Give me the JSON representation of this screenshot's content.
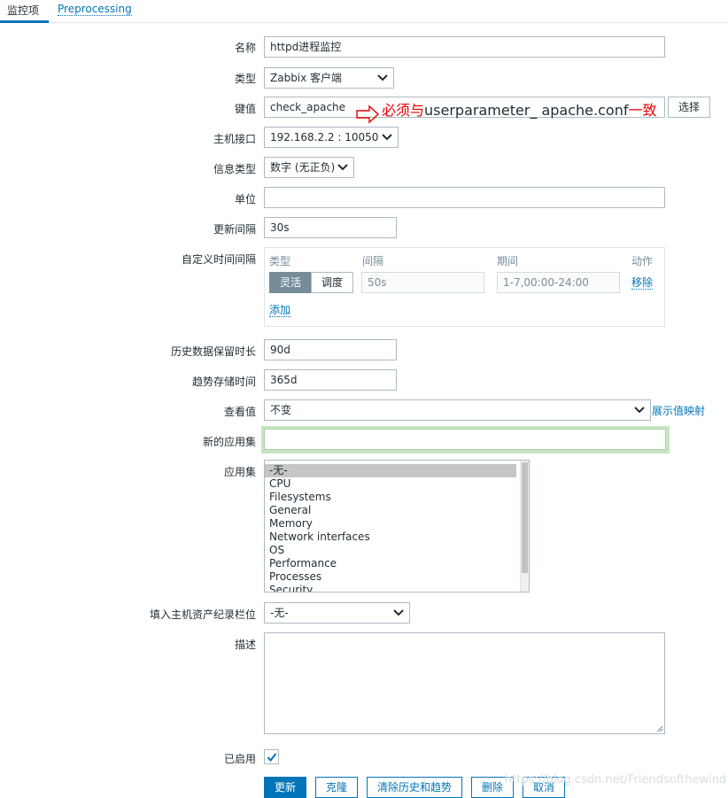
{
  "tabs": {
    "item": "监控项",
    "preprocessing": "Preprocessing"
  },
  "form": {
    "name": {
      "label": "名称",
      "value": "httpd进程监控"
    },
    "type": {
      "label": "类型",
      "value": "Zabbix 客户端"
    },
    "key": {
      "label": "键值",
      "value": "check_apache",
      "select_button": "选择"
    },
    "annotation": {
      "prefix": "必须与",
      "middle": "userparameter_ apache.conf",
      "suffix": "一致"
    },
    "host_interface": {
      "label": "主机接口",
      "value": "192.168.2.2 : 10050"
    },
    "info_type": {
      "label": "信息类型",
      "value": "数字 (无正负)"
    },
    "units": {
      "label": "单位",
      "value": ""
    },
    "update_interval": {
      "label": "更新间隔",
      "value": "30s"
    },
    "custom_intervals": {
      "label": "自定义时间间隔",
      "headers": {
        "type": "类型",
        "interval": "间隔",
        "period": "期间",
        "action": "动作"
      },
      "flexible": "灵活",
      "scheduling": "调度",
      "interval_placeholder": "50s",
      "period_placeholder": "1-7,00:00-24:00",
      "remove": "移除",
      "add": "添加"
    },
    "history": {
      "label": "历史数据保留时长",
      "value": "90d"
    },
    "trends": {
      "label": "趋势存储时间",
      "value": "365d"
    },
    "show_value": {
      "label": "查看值",
      "value": "不变",
      "link": "展示值映射"
    },
    "new_application": {
      "label": "新的应用集",
      "value": ""
    },
    "applications": {
      "label": "应用集",
      "items": [
        "-无-",
        "CPU",
        "Filesystems",
        "General",
        "Memory",
        "Network interfaces",
        "OS",
        "Performance",
        "Processes",
        "Security"
      ],
      "selected": "-无-"
    },
    "inventory": {
      "label": "填入主机资产纪录栏位",
      "value": "-无-"
    },
    "description": {
      "label": "描述",
      "value": ""
    },
    "enabled": {
      "label": "已启用",
      "checked": true
    }
  },
  "buttons": {
    "update": "更新",
    "clone": "克隆",
    "clear": "清除历史和趋势",
    "delete": "删除",
    "cancel": "取消"
  },
  "watermark": "https://blog.csdn.net/Friendsofthewind",
  "colors": {
    "accent": "#0275b8",
    "annotation": "#e60000",
    "highlight": "#c7e5c3"
  }
}
